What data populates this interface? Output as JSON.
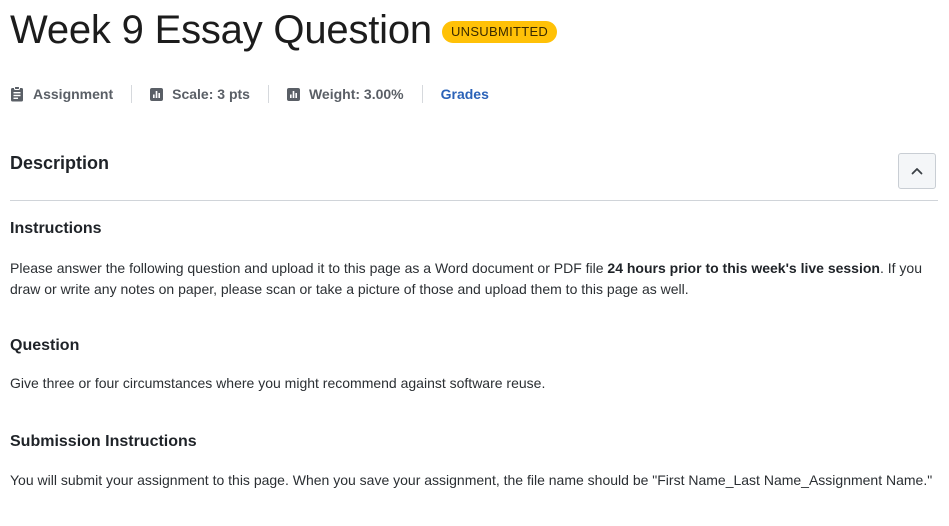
{
  "header": {
    "title": "Week 9 Essay Question",
    "status": "UNSUBMITTED",
    "status_color": "#ffc107"
  },
  "meta": {
    "type_icon": "clipboard-icon",
    "type_label": "Assignment",
    "scale_icon": "bar-chart-icon",
    "scale_label": "Scale: 3 pts",
    "weight_icon": "bar-chart-icon",
    "weight_label": "Weight: 3.00%",
    "grades_link": "Grades",
    "link_color": "#2a62b8"
  },
  "description": {
    "heading": "Description",
    "collapse_icon": "chevron-up-icon"
  },
  "instructions": {
    "heading": "Instructions",
    "text_before": "Please answer the following question and upload it to this page as a Word document or PDF file ",
    "text_bold": "24 hours prior to this week's live session",
    "text_after": ". If you draw or write any notes on paper, please scan or take a picture of those and upload them to this page as well."
  },
  "question": {
    "heading": "Question",
    "text": "Give three or four circumstances where you might recommend against software reuse."
  },
  "submission": {
    "heading": "Submission Instructions",
    "text": "You will submit your assignment to this page. When you save your assignment, the file name should be \"First Name_Last Name_Assignment Name.\""
  }
}
